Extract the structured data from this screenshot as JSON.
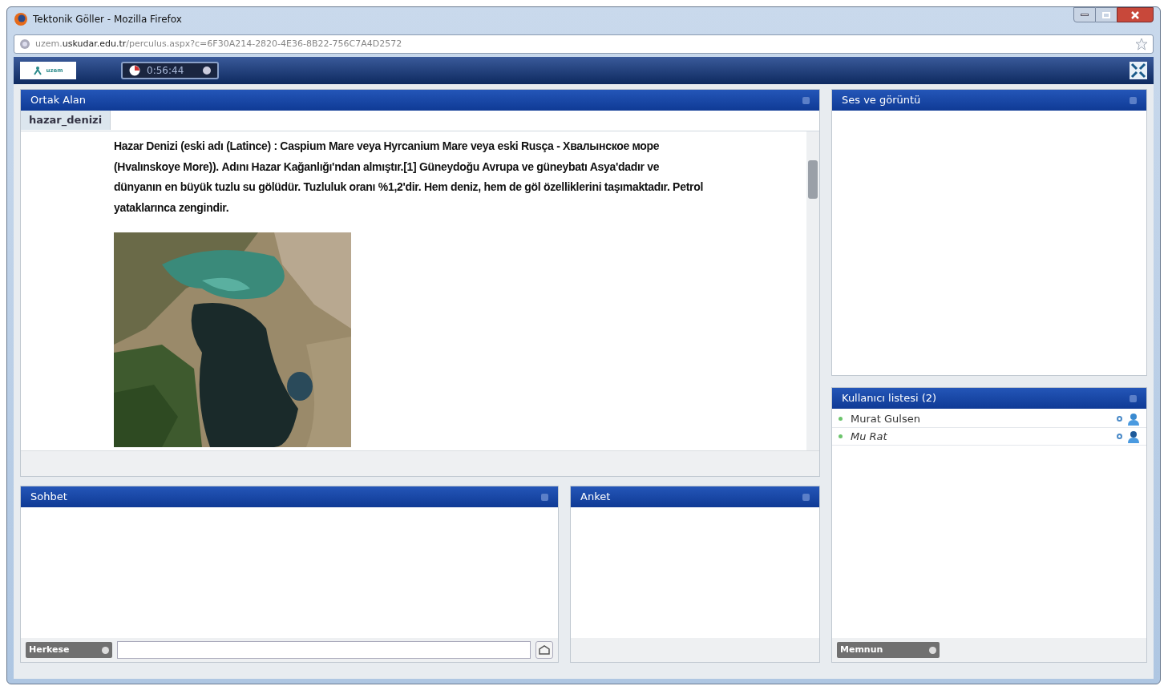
{
  "window": {
    "title": "Tektonik Göller - Mozilla Firefox"
  },
  "address_bar": {
    "host_prefix": "uzem.",
    "host": "uskudar.edu.tr",
    "path": "/perculus.aspx?c=6F30A214-2820-4E36-8B22-756C7A4D2572"
  },
  "toolbar": {
    "logo": "uzem",
    "timer": "0:56:44"
  },
  "shared_area": {
    "title": "Ortak Alan",
    "tabs": [
      {
        "label": "hazar_denizi",
        "selected": true
      }
    ],
    "text": "Hazar Denizi (eski adı (Latince) : Caspium Mare veya Hyrcanium Mare veya eski Rusça - Хвалынское море (Hvalınskoye More)). Adını Hazar Kağanlığı'ndan almıştır.[1] Güneydoğu Avrupa ve güneybatı Asya'dadır ve dünyanın en büyük tuzlu su gölüdür. Tuzluluk oranı %1,2'dir. Hem deniz, hem de göl özelliklerini taşımaktadır. Petrol yataklarınca zengindir."
  },
  "video": {
    "title": "Ses ve görüntü"
  },
  "users": {
    "title": "Kullanıcı listesi (2)",
    "items": [
      {
        "name": "Murat Gulsen",
        "guest": false
      },
      {
        "name": "Mu Rat",
        "guest": true
      }
    ],
    "mood": "Memnun"
  },
  "chat": {
    "title": "Sohbet",
    "recipient": "Herkese"
  },
  "poll": {
    "title": "Anket"
  }
}
